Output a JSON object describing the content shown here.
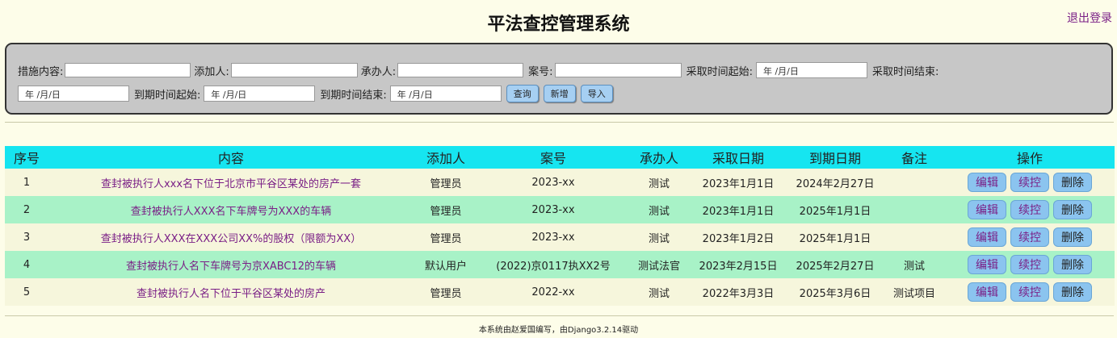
{
  "header": {
    "title": "平法查控管理系统",
    "logout_label": "退出登录"
  },
  "search": {
    "content_label": "措施内容:",
    "adder_label": "添加人:",
    "handler_label": "承办人:",
    "case_label": "案号:",
    "take_start_label": "采取时间起始:",
    "take_start_value": "年 /月/日",
    "take_end_label": "采取时间结束:",
    "take_end_value": "年 /月/日",
    "expire_start_label": "到期时间起始:",
    "expire_start_value": "年 /月/日",
    "expire_end_label": "到期时间结束:",
    "expire_end_value": "年 /月/日",
    "query_label": "查询",
    "add_label": "新增",
    "import_label": "导入"
  },
  "table": {
    "headers": [
      "序号",
      "内容",
      "添加人",
      "案号",
      "承办人",
      "采取日期",
      "到期日期",
      "备注",
      "操作"
    ],
    "rows": [
      {
        "no": "1",
        "content": "查封被执行人xxx名下位于北京市平谷区某处的房产一套",
        "adder": "管理员",
        "case": "2023-xx",
        "handler": "测试",
        "take_date": "2023年1月1日",
        "expire_date": "2024年2月27日",
        "note": ""
      },
      {
        "no": "2",
        "content": "查封被执行人XXX名下车牌号为XXX的车辆",
        "adder": "管理员",
        "case": "2023-xx",
        "handler": "测试",
        "take_date": "2023年1月1日",
        "expire_date": "2025年1月1日",
        "note": ""
      },
      {
        "no": "3",
        "content": "查封被执行人XXX在XXX公司XX%的股权（限额为XX）",
        "adder": "管理员",
        "case": "2023-xx",
        "handler": "测试",
        "take_date": "2023年1月2日",
        "expire_date": "2025年1月1日",
        "note": ""
      },
      {
        "no": "4",
        "content": "查封被执行人名下车牌号为京XABC12的车辆",
        "adder": "默认用户",
        "case": "(2022)京0117执XX2号",
        "handler": "测试法官",
        "take_date": "2023年2月15日",
        "expire_date": "2025年2月27日",
        "note": "测试"
      },
      {
        "no": "5",
        "content": "查封被执行人名下位于平谷区某处的房产",
        "adder": "管理员",
        "case": "2022-xx",
        "handler": "测试",
        "take_date": "2022年3月3日",
        "expire_date": "2025年3月6日",
        "note": "测试项目"
      }
    ],
    "op_edit": "编辑",
    "op_continue": "续控",
    "op_delete": "删除"
  },
  "footer": {
    "text": "本系统由赵爱国编写，由Django3.2.14驱动"
  }
}
